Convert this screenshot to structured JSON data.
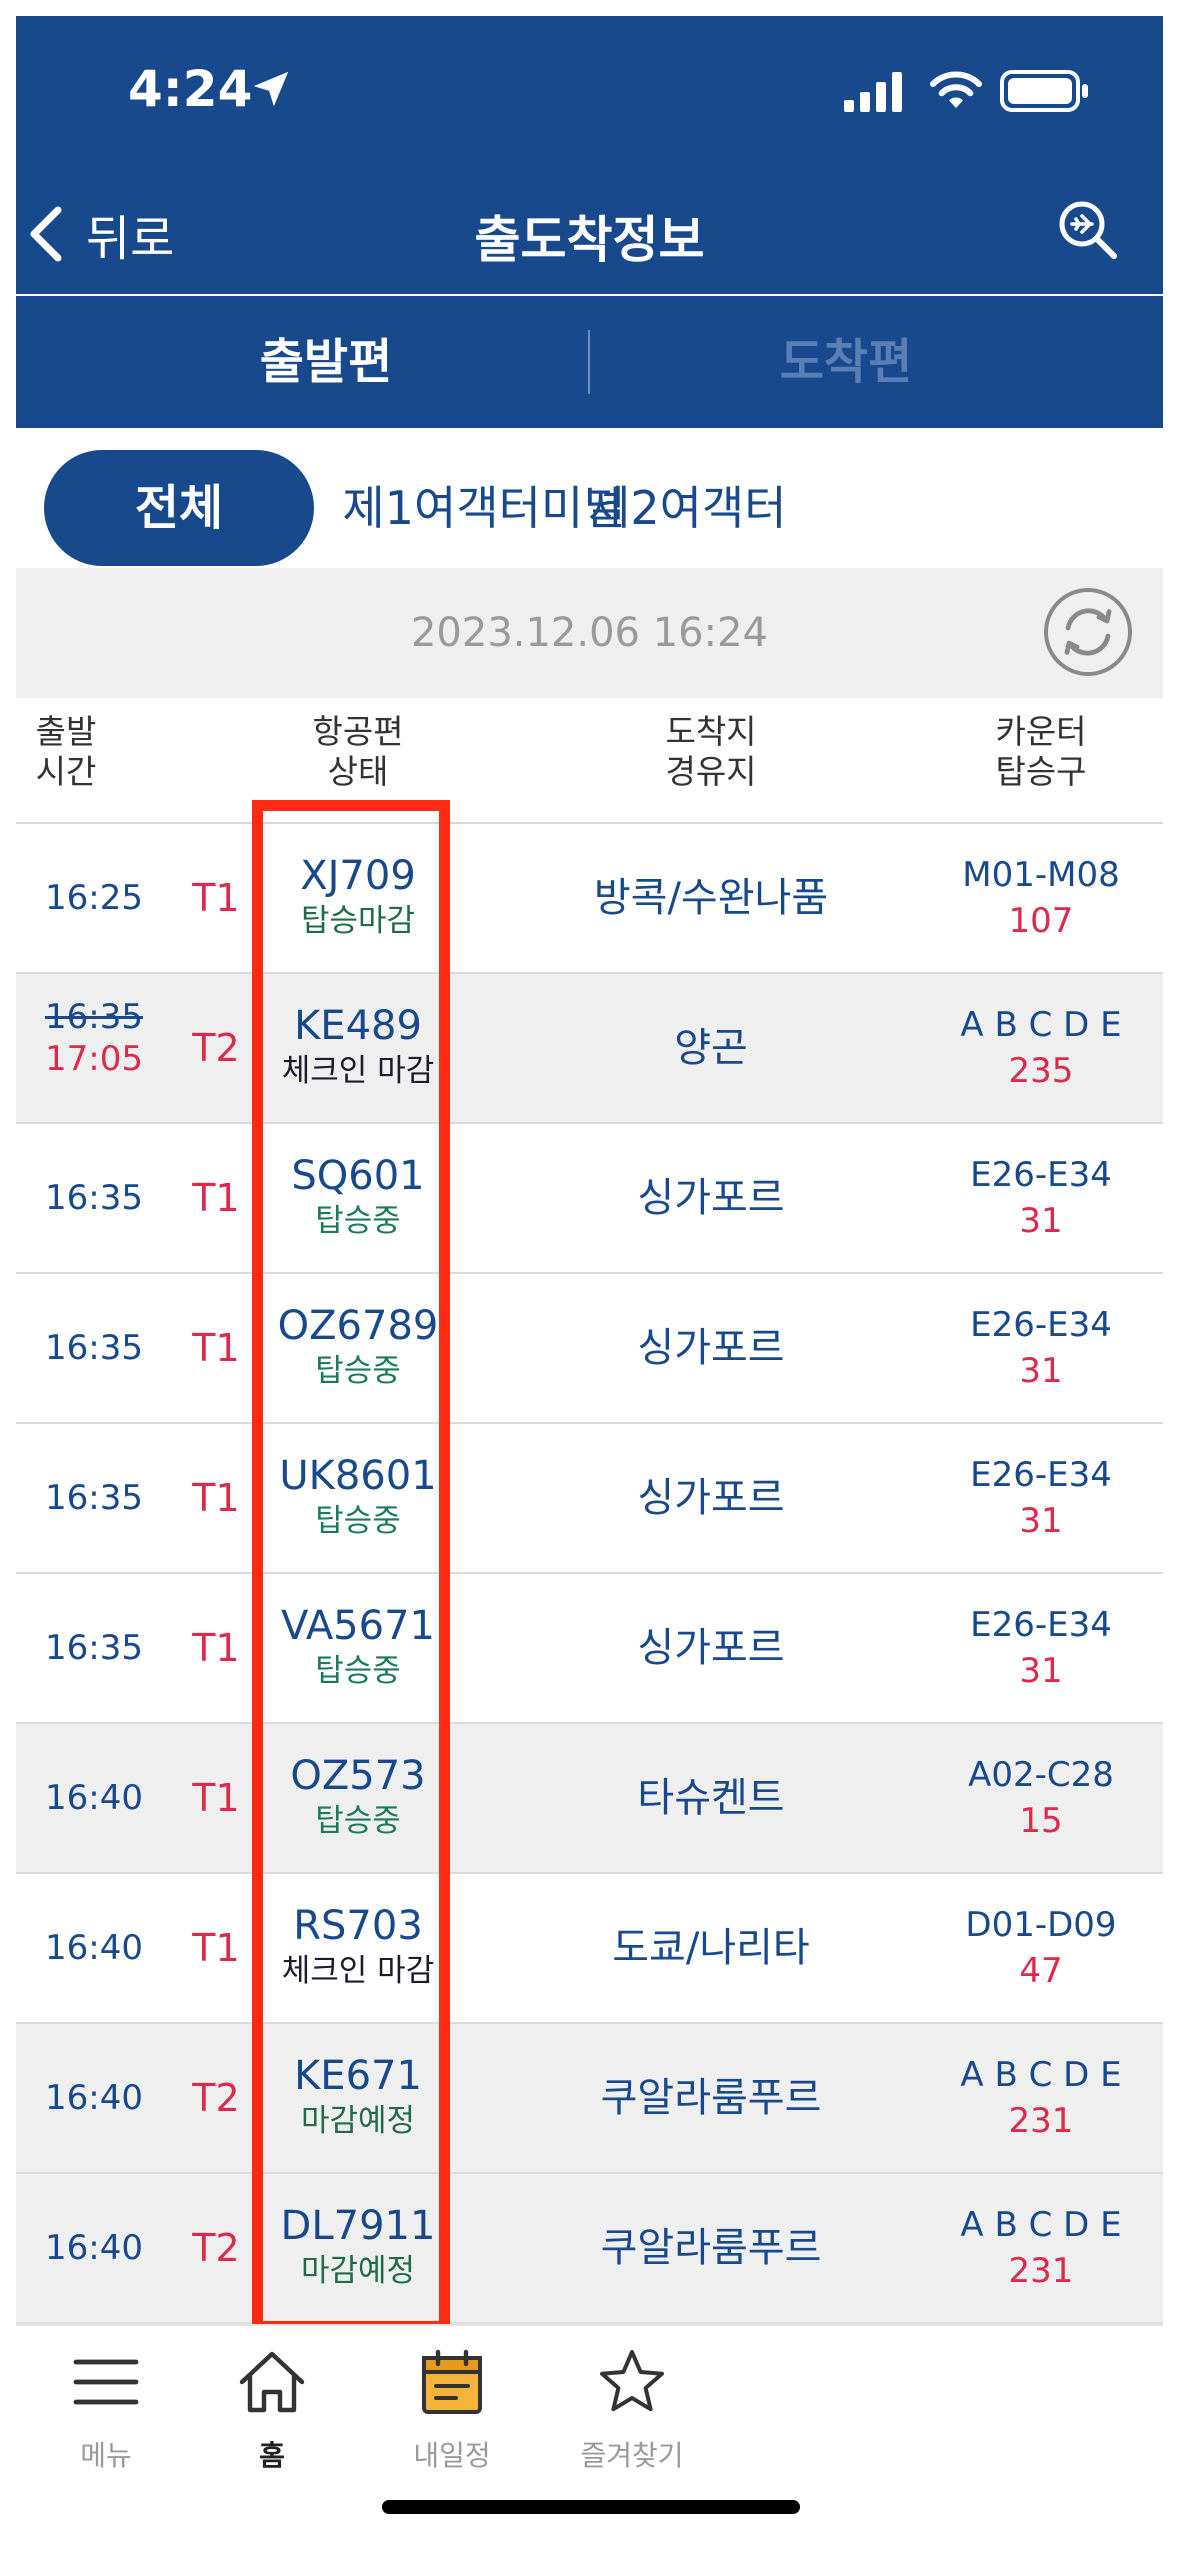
{
  "status_bar": {
    "time": "4:24"
  },
  "nav": {
    "back_label": "뒤로",
    "title": "출도착정보"
  },
  "direction_tabs": {
    "departures": "출발편",
    "arrivals": "도착편"
  },
  "terminal_filter": {
    "all": "전체",
    "t1": "제1여객터미널",
    "t2": "제2여객터"
  },
  "updated_at": "2023.12.06 16:24",
  "columns": {
    "time": [
      "출발",
      "시간"
    ],
    "flight": [
      "항공편",
      "상태"
    ],
    "dest": [
      "도착지",
      "경유지"
    ],
    "counter": [
      "카운터",
      "탑승구"
    ]
  },
  "status_colors": {
    "boarding_closed": "#1f6b4a",
    "checkin_closed": "#1c1c2c",
    "boarding": "#1a7a5e",
    "closing_soon": "#1f6b4a"
  },
  "flights": [
    {
      "time": "16:25",
      "terminal": "T1",
      "flight": "XJ709",
      "status": "탑승마감",
      "status_kind": "boarding_closed",
      "dest": "방콕/수완나품",
      "counter": "M01-M08",
      "gate": "107",
      "grey": false
    },
    {
      "time_old": "16:35",
      "time": "17:05",
      "terminal": "T2",
      "flight": "KE489",
      "status": "체크인 마감",
      "status_kind": "checkin_closed",
      "dest": "양곤",
      "counter": "A B C D E",
      "gate": "235",
      "grey": true
    },
    {
      "time": "16:35",
      "terminal": "T1",
      "flight": "SQ601",
      "status": "탑승중",
      "status_kind": "boarding",
      "dest": "싱가포르",
      "counter": "E26-E34",
      "gate": "31",
      "grey": false
    },
    {
      "time": "16:35",
      "terminal": "T1",
      "flight": "OZ6789",
      "status": "탑승중",
      "status_kind": "boarding",
      "dest": "싱가포르",
      "counter": "E26-E34",
      "gate": "31",
      "grey": false
    },
    {
      "time": "16:35",
      "terminal": "T1",
      "flight": "UK8601",
      "status": "탑승중",
      "status_kind": "boarding",
      "dest": "싱가포르",
      "counter": "E26-E34",
      "gate": "31",
      "grey": false
    },
    {
      "time": "16:35",
      "terminal": "T1",
      "flight": "VA5671",
      "status": "탑승중",
      "status_kind": "boarding",
      "dest": "싱가포르",
      "counter": "E26-E34",
      "gate": "31",
      "grey": false
    },
    {
      "time": "16:40",
      "terminal": "T1",
      "flight": "OZ573",
      "status": "탑승중",
      "status_kind": "boarding",
      "dest": "타슈켄트",
      "counter": "A02-C28",
      "gate": "15",
      "grey": true
    },
    {
      "time": "16:40",
      "terminal": "T1",
      "flight": "RS703",
      "status": "체크인 마감",
      "status_kind": "checkin_closed",
      "dest": "도쿄/나리타",
      "counter": "D01-D09",
      "gate": "47",
      "grey": false
    },
    {
      "time": "16:40",
      "terminal": "T2",
      "flight": "KE671",
      "status": "마감예정",
      "status_kind": "closing_soon",
      "dest": "쿠알라룸푸르",
      "counter": "A B C D E",
      "gate": "231",
      "grey": true
    },
    {
      "time": "16:40",
      "terminal": "T2",
      "flight": "DL7911",
      "status": "마감예정",
      "status_kind": "closing_soon",
      "dest": "쿠알라룸푸르",
      "counter": "A B C D E",
      "gate": "231",
      "grey": true
    }
  ],
  "tabbar": {
    "menu": "메뉴",
    "home": "홈",
    "schedule": "내일정",
    "favorites": "즐겨찾기"
  }
}
